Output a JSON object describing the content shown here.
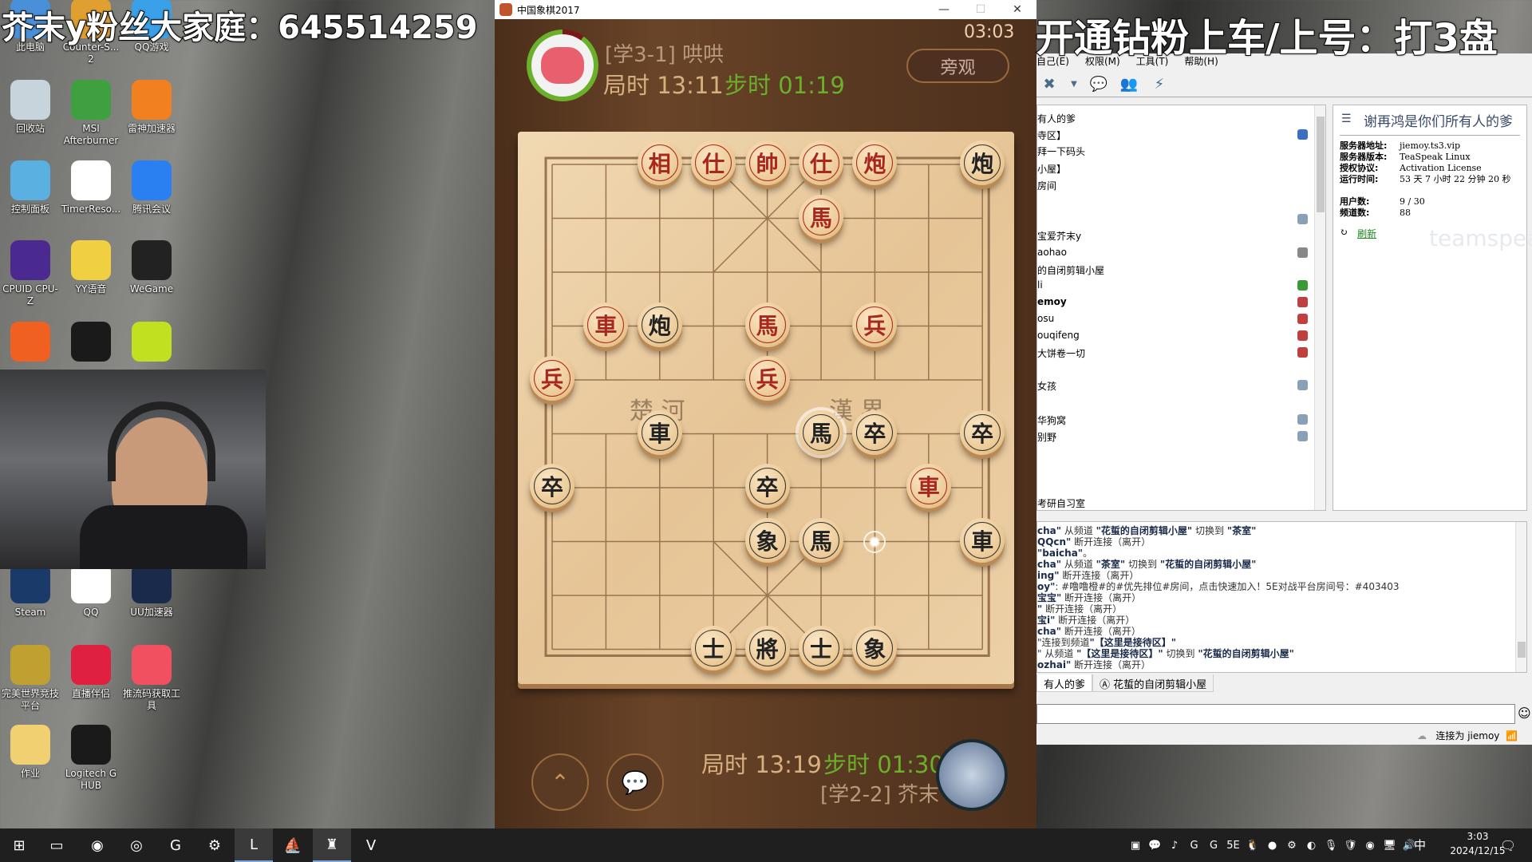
{
  "overlay": {
    "left_text": "芥末y粉丝大家庭：645514259",
    "right_text": "开通钻粉上车/上号：打3盘"
  },
  "desktop_icons": [
    {
      "label": "此电脑",
      "icon": "computer-icon",
      "color": "#4a90d9"
    },
    {
      "label": "Counter-S... 2",
      "icon": "cs2-icon",
      "color": "#e0a030"
    },
    {
      "label": "QQ游戏",
      "icon": "qq-game-icon",
      "color": "#3aa0e8"
    },
    {
      "label": "回收站",
      "icon": "recycle-bin-icon",
      "color": "#c8d4dc"
    },
    {
      "label": "MSI Afterburner",
      "icon": "msi-afterburner-icon",
      "color": "#3fa040"
    },
    {
      "label": "雷神加速器",
      "icon": "leishen-icon",
      "color": "#f08020"
    },
    {
      "label": "控制面板",
      "icon": "control-panel-icon",
      "color": "#5ab0e0"
    },
    {
      "label": "TimerReso...",
      "icon": "clock-icon",
      "color": "#ffffff"
    },
    {
      "label": "腾讯会议",
      "icon": "tencent-meeting-icon",
      "color": "#2a80f0"
    },
    {
      "label": "CPUID CPU-Z",
      "icon": "cpuz-icon",
      "color": "#4a2a90"
    },
    {
      "label": "YY语音",
      "icon": "yy-icon",
      "color": "#f0d040"
    },
    {
      "label": "WeGame",
      "icon": "wegame-icon",
      "color": "#222222"
    },
    {
      "label": "",
      "icon": "app-orange-icon",
      "color": "#f06020"
    },
    {
      "label": "",
      "icon": "kk-icon",
      "color": "#1a1a1a"
    },
    {
      "label": "",
      "icon": "music-icon",
      "color": "#c0e020"
    },
    {
      "label": "Steam",
      "icon": "steam-icon",
      "color": "#1a3a6a"
    },
    {
      "label": "QQ",
      "icon": "qq-icon",
      "color": "#ffffff"
    },
    {
      "label": "UU加速器",
      "icon": "uu-icon",
      "color": "#1a2a4a"
    },
    {
      "label": "完美世界竞技平台",
      "icon": "perfect-world-icon",
      "color": "#c0a030"
    },
    {
      "label": "直播伴侣",
      "icon": "live-companion-icon",
      "color": "#e02040"
    },
    {
      "label": "推流码获取工具",
      "icon": "stream-key-icon",
      "color": "#f05060"
    },
    {
      "label": "作业",
      "icon": "folder-icon",
      "color": "#f0d070"
    },
    {
      "label": "Logitech G HUB",
      "icon": "logitech-icon",
      "color": "#1a1a1a"
    }
  ],
  "chess": {
    "window_title": "中国象棋2017",
    "clock": "03:03",
    "spectate_label": "旁观",
    "top_player": {
      "name": "[学3-1] 哄哄",
      "game_time_label": "局时 13:11",
      "step_time_label": "步时 01:19",
      "timer_progress": 0.9
    },
    "bottom_player": {
      "name": "[学2-2] 芥末",
      "game_time_label": "局时 13:19",
      "step_time_label": "步时 01:30"
    },
    "river_left": "楚 河",
    "river_right": "漢 界",
    "colors": {
      "red": "#a8281e",
      "black": "#222222",
      "step_time": "#6ab02a",
      "game_time": "#d8b080"
    },
    "pieces": [
      {
        "char": "相",
        "side": "red",
        "col": 2,
        "row": 0
      },
      {
        "char": "仕",
        "side": "red",
        "col": 3,
        "row": 0
      },
      {
        "char": "帥",
        "side": "red",
        "col": 4,
        "row": 0
      },
      {
        "char": "仕",
        "side": "red",
        "col": 5,
        "row": 0
      },
      {
        "char": "炮",
        "side": "red",
        "col": 6,
        "row": 0
      },
      {
        "char": "炮",
        "side": "black",
        "col": 8,
        "row": 0
      },
      {
        "char": "馬",
        "side": "red",
        "col": 5,
        "row": 1
      },
      {
        "char": "車",
        "side": "red",
        "col": 1,
        "row": 3
      },
      {
        "char": "炮",
        "side": "black",
        "col": 2,
        "row": 3
      },
      {
        "char": "馬",
        "side": "red",
        "col": 4,
        "row": 3
      },
      {
        "char": "兵",
        "side": "red",
        "col": 6,
        "row": 3
      },
      {
        "char": "兵",
        "side": "red",
        "col": 0,
        "row": 4
      },
      {
        "char": "兵",
        "side": "red",
        "col": 4,
        "row": 4
      },
      {
        "char": "車",
        "side": "black",
        "col": 2,
        "row": 5
      },
      {
        "char": "馬",
        "side": "black",
        "col": 5,
        "row": 5,
        "last_move": true
      },
      {
        "char": "卒",
        "side": "black",
        "col": 6,
        "row": 5
      },
      {
        "char": "卒",
        "side": "black",
        "col": 8,
        "row": 5
      },
      {
        "char": "卒",
        "side": "black",
        "col": 0,
        "row": 6
      },
      {
        "char": "卒",
        "side": "black",
        "col": 4,
        "row": 6
      },
      {
        "char": "車",
        "side": "red",
        "col": 7,
        "row": 6
      },
      {
        "char": "象",
        "side": "black",
        "col": 4,
        "row": 7
      },
      {
        "char": "馬",
        "side": "black",
        "col": 5,
        "row": 7
      },
      {
        "char": "車",
        "side": "black",
        "col": 8,
        "row": 7
      },
      {
        "char": "士",
        "side": "black",
        "col": 3,
        "row": 9
      },
      {
        "char": "將",
        "side": "black",
        "col": 4,
        "row": 9
      },
      {
        "char": "士",
        "side": "black",
        "col": 5,
        "row": 9
      },
      {
        "char": "象",
        "side": "black",
        "col": 6,
        "row": 9
      }
    ],
    "move_from": {
      "col": 6,
      "row": 7
    }
  },
  "teamspeak": {
    "menu": [
      "自己(E)",
      "权限(M)",
      "工具(T)",
      "帮助(H)"
    ],
    "channels": [
      {
        "label": "有人的爹"
      },
      {
        "label": "寺区】"
      },
      {
        "label": "拜一下码头"
      },
      {
        "label": "小屋】"
      },
      {
        "label": "房间"
      },
      {
        "label": "宝爱芥末y"
      },
      {
        "label": "aohao"
      },
      {
        "label": "的自闭剪辑小屋"
      },
      {
        "label": "li"
      },
      {
        "label": "emoy",
        "bold": true
      },
      {
        "label": "osu"
      },
      {
        "label": "ouqifeng"
      },
      {
        "label": "大饼卷一切"
      },
      {
        "label": "女孩"
      },
      {
        "label": "华狗窝"
      },
      {
        "label": "别野"
      },
      {
        "label": "考研自习室"
      }
    ],
    "server_info": {
      "name": "谢再鸿是你们所有人的爹",
      "rows": [
        {
          "key": "服务器地址:",
          "value": "jiemoy.ts3.vip"
        },
        {
          "key": "服务器版本:",
          "value": "TeaSpeak Linux"
        },
        {
          "key": "授权协议:",
          "value": "Activation License"
        },
        {
          "key": "运行时间:",
          "value": "53 天 7 小时 22 分钟 20 秒"
        },
        {
          "key": "用户数:",
          "value": "9 / 30"
        },
        {
          "key": "频道数:",
          "value": "88"
        }
      ],
      "refresh_label": "刷新",
      "watermark": "teamspeak"
    },
    "chat_lines": [
      [
        {
          "t": "cha\"",
          "b": true
        },
        {
          "t": " 从频道 "
        },
        {
          "t": "\"花蜇的自闭剪辑小屋\"",
          "b": true
        },
        {
          "t": " 切换到 "
        },
        {
          "t": "\"茶室\"",
          "b": true
        }
      ],
      [
        {
          "t": "QQcn\"",
          "b": true
        },
        {
          "t": " 断开连接（离开）"
        }
      ],
      [
        {
          "t": "\"baicha\"",
          "b": true
        },
        {
          "t": "。"
        }
      ],
      [
        {
          "t": "cha\"",
          "b": true
        },
        {
          "t": " 从频道 "
        },
        {
          "t": "\"茶室\"",
          "b": true
        },
        {
          "t": " 切换到 "
        },
        {
          "t": "\"花蜇的自闭剪辑小屋\"",
          "b": true
        }
      ],
      [
        {
          "t": "ing\"",
          "b": true
        },
        {
          "t": " 断开连接（离开）"
        }
      ],
      [
        {
          "t": "oy\"",
          "b": true
        },
        {
          "t": ": #噜噜橙#的#优先排位#房间，点击快速加入！5E对战平台房间号：#403403"
        }
      ],
      [
        {
          "t": "宝宝\"",
          "b": true
        },
        {
          "t": " 断开连接（离开）"
        }
      ],
      [
        {
          "t": "\"",
          "b": true
        },
        {
          "t": " 断开连接（离开）"
        }
      ],
      [
        {
          "t": "宝i\"",
          "b": true
        },
        {
          "t": " 断开连接（离开）"
        }
      ],
      [
        {
          "t": "cha\"",
          "b": true
        },
        {
          "t": " 断开连接（离开）"
        }
      ],
      [
        {
          "t": "\"连接到频道"
        },
        {
          "t": "\"【这里是接待区】\"",
          "b": true
        }
      ],
      [
        {
          "t": "\" 从频道 "
        },
        {
          "t": "\"【这里是接待区】\"",
          "b": true
        },
        {
          "t": " 切换到 "
        },
        {
          "t": "\"花蜇的自闭剪辑小屋\"",
          "b": true
        }
      ],
      [
        {
          "t": "ozhai\"",
          "b": true
        },
        {
          "t": " 断开连接（离开）"
        }
      ]
    ],
    "tabs": [
      {
        "label": "有人的爹",
        "active": true
      },
      {
        "label": "花蜇的自闭剪辑小屋"
      }
    ],
    "chat_input_value": "",
    "status_text": "连接为 jiemoy"
  },
  "taskbar": {
    "apps": [
      "start-icon",
      "task-view-icon",
      "browser-icon",
      "obs-icon",
      "app-g-icon",
      "steam-icon",
      "league-icon",
      "boat-icon",
      "chinese-chess-icon",
      "valorant-icon"
    ],
    "tray": [
      "nvidia-icon",
      "chat-icon",
      "music-icon",
      "g-app-icon",
      "logitech-icon",
      "5e-icon",
      "qq-icon",
      "sphere-icon",
      "steam-icon",
      "obs-icon",
      "microphone-icon",
      "shield-icon",
      "orange-app-icon",
      "network-icon",
      "volume-icon"
    ],
    "ime": "中",
    "time": "3:03",
    "date": "2024/12/15"
  }
}
